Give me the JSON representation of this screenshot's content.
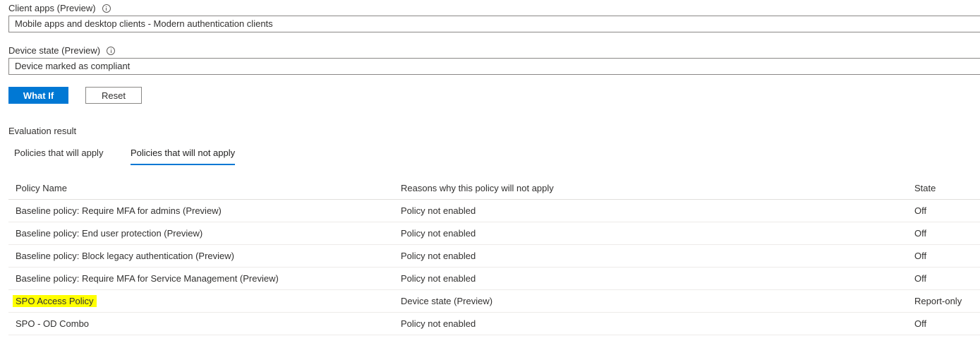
{
  "client_apps": {
    "label": "Client apps (Preview)",
    "value": "Mobile apps and desktop clients - Modern authentication clients"
  },
  "device_state": {
    "label": "Device state (Preview)",
    "value": "Device marked as compliant"
  },
  "buttons": {
    "what_if": "What If",
    "reset": "Reset"
  },
  "evaluation": {
    "title": "Evaluation result",
    "tabs": [
      {
        "label": "Policies that will apply",
        "active": false
      },
      {
        "label": "Policies that will not apply",
        "active": true
      }
    ]
  },
  "table": {
    "headers": [
      "Policy Name",
      "Reasons why this policy will not apply",
      "State"
    ],
    "rows": [
      {
        "name": "Baseline policy: Require MFA for admins (Preview)",
        "reason": "Policy not enabled",
        "state": "Off"
      },
      {
        "name": "Baseline policy: End user protection (Preview)",
        "reason": "Policy not enabled",
        "state": "Off"
      },
      {
        "name": "Baseline policy: Block legacy authentication (Preview)",
        "reason": "Policy not enabled",
        "state": "Off"
      },
      {
        "name": "Baseline policy: Require MFA for Service Management (Preview)",
        "reason": "Policy not enabled",
        "state": "Off"
      },
      {
        "name": "SPO Access Policy",
        "reason": "Device state (Preview)",
        "state": "Report-only",
        "highlighted": true
      },
      {
        "name": "SPO - OD Combo",
        "reason": "Policy not enabled",
        "state": "Off"
      }
    ]
  },
  "colors": {
    "accent": "#0078d4",
    "highlight": "#ffff00"
  }
}
